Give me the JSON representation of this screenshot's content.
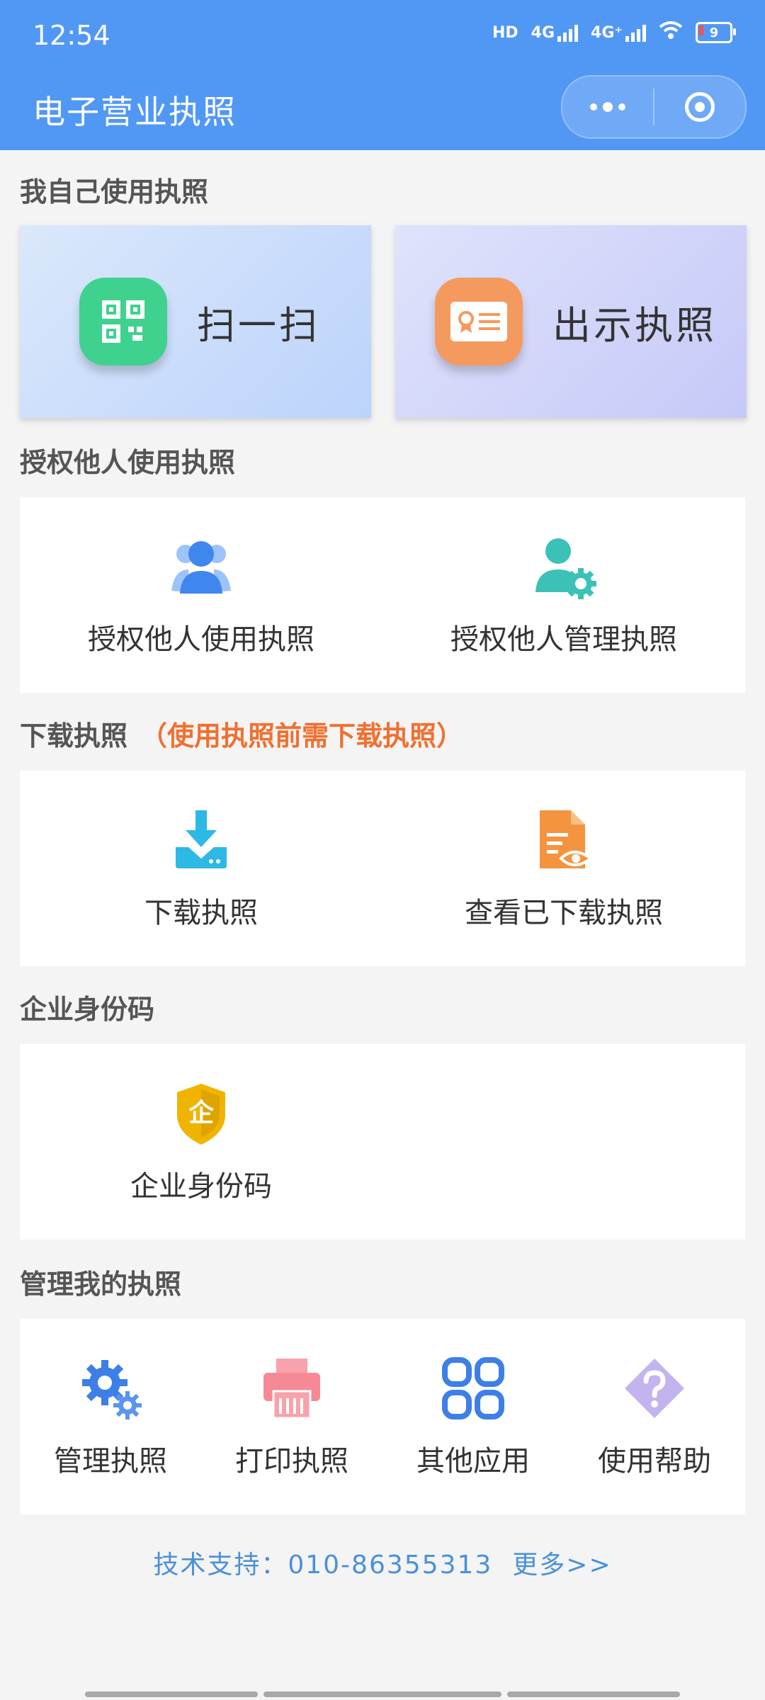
{
  "status": {
    "time": "12:54",
    "hd": "HD",
    "net1": "4G",
    "net2": "4G⁺",
    "battery": "9"
  },
  "header": {
    "title": "电子营业执照"
  },
  "sections": {
    "self": "我自己使用执照",
    "authorize": "授权他人使用执照",
    "download": "下载执照",
    "download_note": "（使用执照前需下载执照）",
    "enterprise": "企业身份码",
    "manage": "管理我的执照"
  },
  "self_cards": {
    "scan": "扫一扫",
    "show": "出示执照"
  },
  "authorize_items": {
    "use": "授权他人使用执照",
    "manage": "授权他人管理执照"
  },
  "download_items": {
    "download": "下载执照",
    "view": "查看已下载执照"
  },
  "enterprise_items": {
    "code": "企业身份码",
    "code_glyph": "企"
  },
  "manage_items": {
    "manage": "管理执照",
    "print": "打印执照",
    "other": "其他应用",
    "help": "使用帮助"
  },
  "footer": {
    "support": "技术支持：010-86355313",
    "more": "更多>>"
  },
  "colors": {
    "header": "#5198f5",
    "note": "#f07030",
    "link": "#4a90d9"
  }
}
